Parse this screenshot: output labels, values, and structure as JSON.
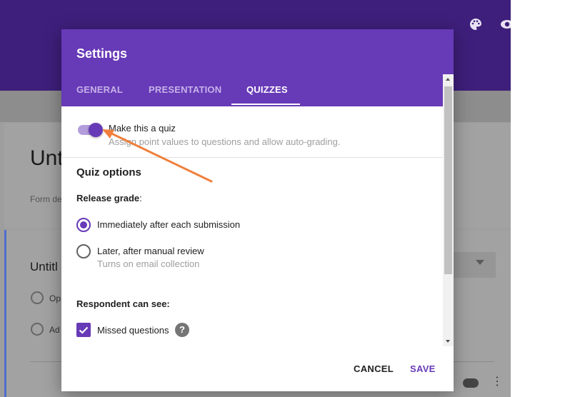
{
  "background": {
    "header_icons": [
      "palette-icon",
      "eye-icon"
    ],
    "form_title_partial": "Unt",
    "form_description_partial": "Form de",
    "question_title_partial": "Untitl",
    "option_partial": "Op",
    "add_option_partial": "Ad"
  },
  "dialog": {
    "title": "Settings",
    "tabs": [
      {
        "label": "GENERAL",
        "active": false
      },
      {
        "label": "PRESENTATION",
        "active": false
      },
      {
        "label": "QUIZZES",
        "active": true
      }
    ],
    "make_quiz": {
      "label": "Make this a quiz",
      "description": "Assign point values to questions and allow auto-grading.",
      "enabled": true
    },
    "quiz_options": {
      "heading": "Quiz options",
      "release_grade": {
        "label": "Release grade",
        "colon": ":",
        "options": [
          {
            "label": "Immediately after each submission",
            "selected": true
          },
          {
            "label": "Later, after manual review",
            "description": "Turns on email collection",
            "selected": false
          }
        ]
      },
      "respondent_can_see": {
        "label": "Respondent can see:",
        "items": [
          {
            "label": "Missed questions",
            "checked": true,
            "help_icon": "help-icon"
          }
        ]
      }
    },
    "buttons": {
      "cancel": "CANCEL",
      "save": "SAVE"
    }
  },
  "colors": {
    "header_purple": "#673ab7",
    "page_header": "#3e1f7b",
    "annotation_arrow": "#f07f3c"
  }
}
